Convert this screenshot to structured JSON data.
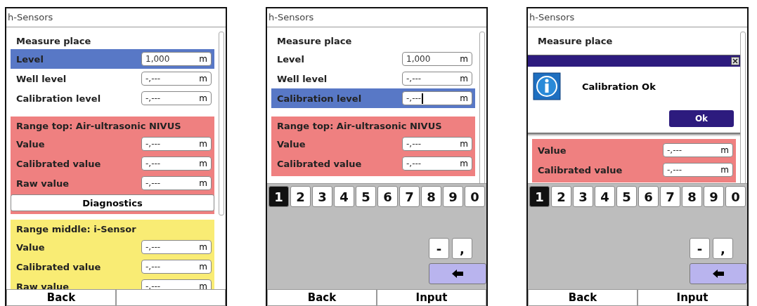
{
  "screens": [
    {
      "title": "h-Sensors",
      "sections": [
        {
          "header": "Measure place",
          "color": "#ffffff",
          "rows": [
            {
              "label": "Level",
              "value": "1,000",
              "unit": "m",
              "selected": true,
              "cursor": false
            },
            {
              "label": "Well level",
              "value": "-,---",
              "unit": "m",
              "selected": false,
              "cursor": false
            },
            {
              "label": "Calibration level",
              "value": "-,---",
              "unit": "m",
              "selected": false,
              "cursor": false
            }
          ]
        },
        {
          "header": "Range top: Air-ultrasonic NIVUS",
          "color": "#ef8080",
          "rows": [
            {
              "label": "Value",
              "value": "-,---",
              "unit": "m",
              "selected": false,
              "cursor": false
            },
            {
              "label": "Calibrated value",
              "value": "-,---",
              "unit": "m",
              "selected": false,
              "cursor": false
            },
            {
              "label": "Raw value",
              "value": "-,---",
              "unit": "m",
              "selected": false,
              "cursor": false
            }
          ],
          "button": "Diagnostics"
        },
        {
          "header": "Range middle: i-Sensor",
          "color": "#f9ec74",
          "rows": [
            {
              "label": "Value",
              "value": "-,---",
              "unit": "m",
              "selected": false,
              "cursor": false
            },
            {
              "label": "Calibrated value",
              "value": "-,---",
              "unit": "m",
              "selected": false,
              "cursor": false
            },
            {
              "label": "Raw value",
              "value": "-,---",
              "unit": "m",
              "selected": false,
              "cursor": false
            }
          ]
        }
      ],
      "buttons": [
        "Back"
      ]
    },
    {
      "title": "h-Sensors",
      "sections": [
        {
          "header": "Measure place",
          "color": "#ffffff",
          "rows": [
            {
              "label": "Level",
              "value": "1,000",
              "unit": "m",
              "selected": false,
              "cursor": false
            },
            {
              "label": "Well level",
              "value": "-,---",
              "unit": "m",
              "selected": false,
              "cursor": false
            },
            {
              "label": "Calibration level",
              "value": "-,---",
              "unit": "m",
              "selected": true,
              "cursor": true
            }
          ]
        },
        {
          "header": "Range top: Air-ultrasonic NIVUS",
          "color": "#ef8080",
          "rows": [
            {
              "label": "Value",
              "value": "-,---",
              "unit": "m",
              "selected": false,
              "cursor": false
            },
            {
              "label": "Calibrated value",
              "value": "-,---",
              "unit": "m",
              "selected": false,
              "cursor": false
            }
          ]
        }
      ],
      "keyboard": {
        "keys": [
          {
            "label": "1",
            "selected": true
          },
          {
            "label": "2",
            "selected": false
          },
          {
            "label": "3",
            "selected": false
          },
          {
            "label": "4",
            "selected": false
          },
          {
            "label": "5",
            "selected": false
          },
          {
            "label": "6",
            "selected": false
          },
          {
            "label": "7",
            "selected": false
          },
          {
            "label": "8",
            "selected": false
          },
          {
            "label": "9",
            "selected": false
          },
          {
            "label": "0",
            "selected": false
          }
        ],
        "extra_keys": [
          "-",
          ","
        ]
      },
      "buttons": [
        "Back",
        "Input"
      ]
    },
    {
      "title": "h-Sensors",
      "sections": [
        {
          "header": "Measure place",
          "color": "#ffffff"
        },
        {
          "color": "#ef8080",
          "rows": [
            {
              "label": "Value",
              "value": "-,---",
              "unit": "m",
              "selected": false,
              "cursor": false
            },
            {
              "label": "Calibrated value",
              "value": "-,---",
              "unit": "m",
              "selected": false,
              "cursor": false
            }
          ]
        }
      ],
      "dialog": {
        "message": "Calibration Ok",
        "button": "Ok"
      },
      "keyboard": {
        "keys": [
          {
            "label": "1",
            "selected": true
          },
          {
            "label": "2",
            "selected": false
          },
          {
            "label": "3",
            "selected": false
          },
          {
            "label": "4",
            "selected": false
          },
          {
            "label": "5",
            "selected": false
          },
          {
            "label": "6",
            "selected": false
          },
          {
            "label": "7",
            "selected": false
          },
          {
            "label": "8",
            "selected": false
          },
          {
            "label": "9",
            "selected": false
          },
          {
            "label": "0",
            "selected": false
          }
        ],
        "extra_keys": [
          "-",
          ","
        ]
      },
      "buttons": [
        "Back",
        "Input"
      ]
    }
  ]
}
